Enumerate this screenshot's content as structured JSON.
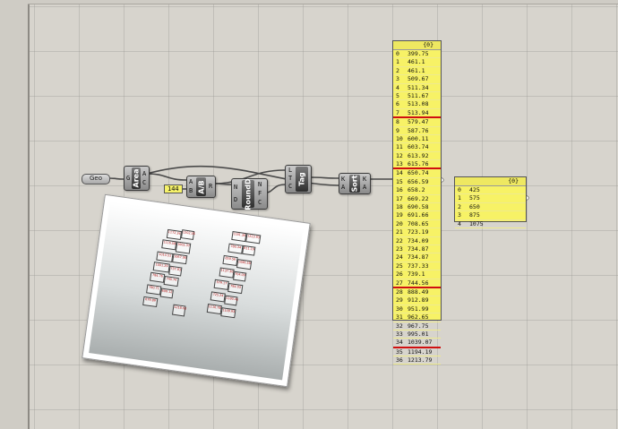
{
  "components": {
    "geo": {
      "label": "Geo"
    },
    "area": {
      "label": "Area",
      "inputs": [
        "G"
      ],
      "outputs": [
        "A",
        "C"
      ]
    },
    "slider": {
      "value": "144"
    },
    "divide": {
      "label": "A/B",
      "inputs": [
        "A",
        "B"
      ],
      "outputs": [
        "R"
      ]
    },
    "round": {
      "label": "RoundD",
      "inputs": [
        "N",
        "D"
      ],
      "outputs": [
        "N",
        "F",
        "C"
      ]
    },
    "tag": {
      "label": "Tag",
      "inputs": [
        "L",
        "T",
        "C"
      ]
    },
    "sort": {
      "label": "Sort",
      "inputs": [
        "K",
        "A"
      ],
      "outputs": [
        "K",
        "A"
      ]
    }
  },
  "panel_main": {
    "header": "{0}",
    "rows": [
      {
        "i": "0",
        "v": "399.75"
      },
      {
        "i": "1",
        "v": "461.1"
      },
      {
        "i": "2",
        "v": "461.1"
      },
      {
        "i": "3",
        "v": "509.67"
      },
      {
        "i": "4",
        "v": "511.34"
      },
      {
        "i": "5",
        "v": "511.67"
      },
      {
        "i": "6",
        "v": "513.08"
      },
      {
        "i": "7",
        "v": "513.94"
      },
      {
        "i": "8",
        "v": "579.47"
      },
      {
        "i": "9",
        "v": "587.76"
      },
      {
        "i": "10",
        "v": "600.11"
      },
      {
        "i": "11",
        "v": "603.74"
      },
      {
        "i": "12",
        "v": "613.92"
      },
      {
        "i": "13",
        "v": "615.76"
      },
      {
        "i": "14",
        "v": "650.74"
      },
      {
        "i": "15",
        "v": "656.59"
      },
      {
        "i": "16",
        "v": "658.2"
      },
      {
        "i": "17",
        "v": "669.22"
      },
      {
        "i": "18",
        "v": "690.58"
      },
      {
        "i": "19",
        "v": "691.66"
      },
      {
        "i": "20",
        "v": "708.65"
      },
      {
        "i": "21",
        "v": "723.19"
      },
      {
        "i": "22",
        "v": "734.09"
      },
      {
        "i": "23",
        "v": "734.87"
      },
      {
        "i": "24",
        "v": "734.87"
      },
      {
        "i": "25",
        "v": "737.33"
      },
      {
        "i": "26",
        "v": "739.1"
      },
      {
        "i": "27",
        "v": "744.56"
      },
      {
        "i": "28",
        "v": "888.49"
      },
      {
        "i": "29",
        "v": "912.89"
      },
      {
        "i": "30",
        "v": "951.99"
      },
      {
        "i": "31",
        "v": "962.65"
      },
      {
        "i": "32",
        "v": "967.75"
      },
      {
        "i": "33",
        "v": "995.01"
      },
      {
        "i": "34",
        "v": "1039.07"
      },
      {
        "i": "35",
        "v": "1194.19"
      },
      {
        "i": "36",
        "v": "1213.79"
      }
    ],
    "separators_after": [
      "7",
      "13",
      "27",
      "34"
    ]
  },
  "panel_thresholds": {
    "header": "{0}",
    "rows": [
      {
        "i": "0",
        "v": "425"
      },
      {
        "i": "1",
        "v": "575"
      },
      {
        "i": "2",
        "v": "650"
      },
      {
        "i": "3",
        "v": "875"
      },
      {
        "i": "4",
        "v": "1075"
      }
    ]
  },
  "plan_labels": [
    "1172.34",
    "1202.56",
    "1116.58",
    "1005.37",
    "1014.51",
    "1067.06",
    "1001.29",
    "737.83",
    "784.76",
    "745.74",
    "780.71",
    "699.12",
    "679.89",
    "1218.63",
    "1181.30",
    "1223.93",
    "780.34",
    "811.19",
    "850.56",
    "1086.58",
    "1137.30",
    "704.09",
    "679.17",
    "784.03",
    "725.24",
    "1180.45",
    "1116.78",
    "1109.93"
  ],
  "colors": {
    "panel": "#f7f266",
    "separator": "#d01010",
    "slider": "#f6f26a"
  }
}
